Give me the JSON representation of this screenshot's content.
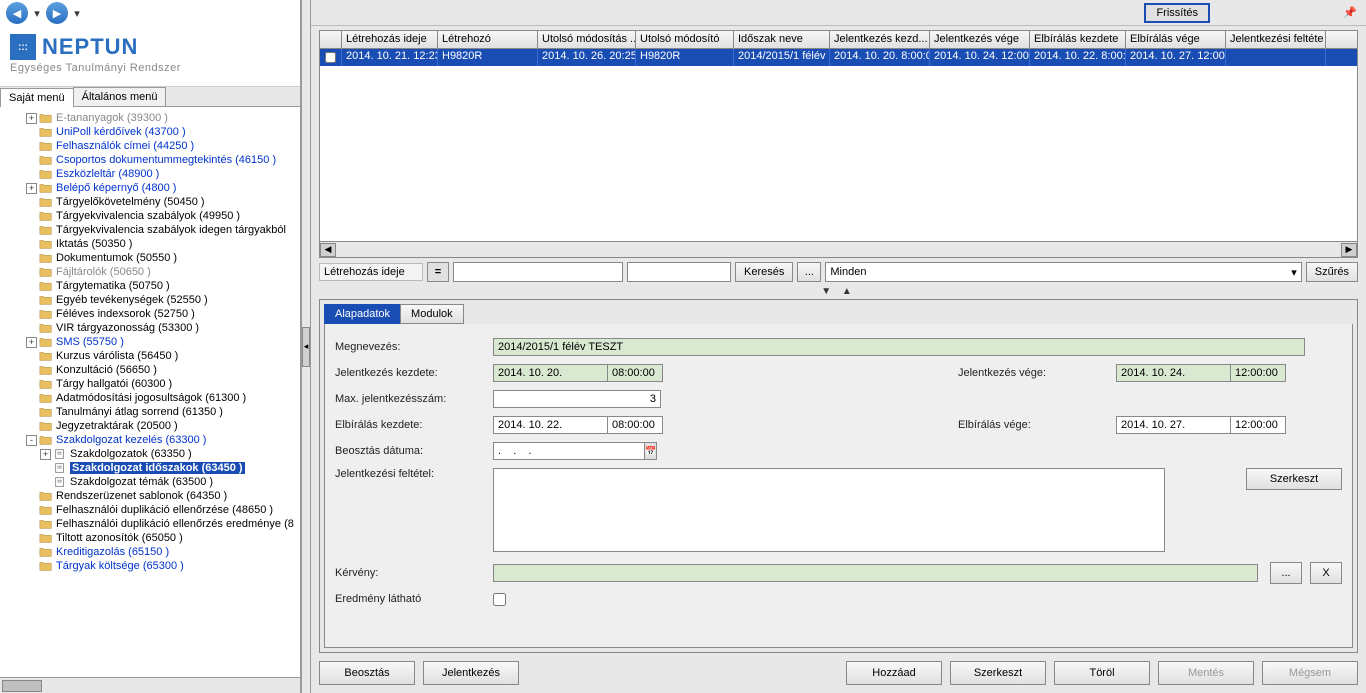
{
  "logo": {
    "name": "NEPTUN",
    "sub": "Egységes Tanulmányi Rendszer"
  },
  "menuTabs": {
    "own": "Saját menü",
    "general": "Általános menü"
  },
  "topbar": {
    "refresh": "Frissítés"
  },
  "tree": [
    {
      "d": 1,
      "exp": "+",
      "label": "E-tananyagok (39300  )",
      "cls": "grey"
    },
    {
      "d": 1,
      "exp": "",
      "label": "UniPoll kérdőívek (43700  )",
      "cls": "link"
    },
    {
      "d": 1,
      "exp": "",
      "label": "Felhasználók címei (44250  )",
      "cls": "link"
    },
    {
      "d": 1,
      "exp": "",
      "label": "Csoportos dokumentummegtekintés (46150  )",
      "cls": "link"
    },
    {
      "d": 1,
      "exp": "",
      "label": "Eszközleltár (48900  )",
      "cls": "link"
    },
    {
      "d": 1,
      "exp": "+",
      "label": "Belépő képernyő (4800  )",
      "cls": "link"
    },
    {
      "d": 1,
      "exp": "",
      "label": "Tárgyelőkövetelmény (50450  )",
      "cls": ""
    },
    {
      "d": 1,
      "exp": "",
      "label": "Tárgyekvivalencia szabályok (49950  )",
      "cls": ""
    },
    {
      "d": 1,
      "exp": "",
      "label": "Tárgyekvivalencia szabályok idegen tárgyakból",
      "cls": ""
    },
    {
      "d": 1,
      "exp": "",
      "label": "Iktatás (50350  )",
      "cls": ""
    },
    {
      "d": 1,
      "exp": "",
      "label": "Dokumentumok (50550  )",
      "cls": ""
    },
    {
      "d": 1,
      "exp": "",
      "label": "Fájltárolók (50650  )",
      "cls": "grey"
    },
    {
      "d": 1,
      "exp": "",
      "label": "Tárgytematika (50750  )",
      "cls": ""
    },
    {
      "d": 1,
      "exp": "",
      "label": "Egyéb tevékenységek (52550  )",
      "cls": ""
    },
    {
      "d": 1,
      "exp": "",
      "label": "Féléves indexsorok (52750  )",
      "cls": ""
    },
    {
      "d": 1,
      "exp": "",
      "label": "VIR tárgyazonosság (53300  )",
      "cls": ""
    },
    {
      "d": 1,
      "exp": "+",
      "label": "SMS (55750  )",
      "cls": "link"
    },
    {
      "d": 1,
      "exp": "",
      "label": "Kurzus várólista (56450  )",
      "cls": ""
    },
    {
      "d": 1,
      "exp": "",
      "label": "Konzultáció (56650  )",
      "cls": ""
    },
    {
      "d": 1,
      "exp": "",
      "label": "Tárgy hallgatói (60300  )",
      "cls": ""
    },
    {
      "d": 1,
      "exp": "",
      "label": "Adatmódosítási jogosultságok (61300  )",
      "cls": ""
    },
    {
      "d": 1,
      "exp": "",
      "label": "Tanulmányi átlag sorrend (61350  )",
      "cls": ""
    },
    {
      "d": 1,
      "exp": "",
      "label": "Jegyzetraktárak (20500  )",
      "cls": ""
    },
    {
      "d": 1,
      "exp": "-",
      "label": "Szakdolgozat kezelés (63300  )",
      "cls": "link"
    },
    {
      "d": 2,
      "exp": "+",
      "label": "Szakdolgozatok (63350  )",
      "cls": "",
      "doc": true
    },
    {
      "d": 2,
      "exp": "",
      "label": "Szakdolgozat időszakok (63450  )",
      "cls": "selected",
      "doc": true
    },
    {
      "d": 2,
      "exp": "",
      "label": "Szakdolgozat témák (63500  )",
      "cls": "",
      "doc": true
    },
    {
      "d": 1,
      "exp": "",
      "label": "Rendszerüzenet sablonok (64350  )",
      "cls": ""
    },
    {
      "d": 1,
      "exp": "",
      "label": "Felhasználói duplikáció ellenőrzése (48650  )",
      "cls": ""
    },
    {
      "d": 1,
      "exp": "",
      "label": "Felhasználói duplikáció ellenőrzés eredménye (8",
      "cls": ""
    },
    {
      "d": 1,
      "exp": "",
      "label": "Tiltott azonosítók (65050  )",
      "cls": ""
    },
    {
      "d": 1,
      "exp": "",
      "label": "Kreditigazolás (65150  )",
      "cls": "link"
    },
    {
      "d": 1,
      "exp": "",
      "label": "Tárgyak költsége (65300  )",
      "cls": "link"
    }
  ],
  "grid": {
    "headers": [
      "",
      "Létrehozás ideje",
      "Létrehozó",
      "Utolsó módosítás ...",
      "Utolsó módosító",
      "Időszak neve",
      "Jelentkezés kezd...",
      "Jelentkezés vége",
      "Elbírálás kezdete",
      "Elbírálás vége",
      "Jelentkezési feltéte"
    ],
    "widths": [
      22,
      96,
      100,
      98,
      98,
      96,
      100,
      100,
      96,
      100,
      100
    ],
    "row": [
      "",
      "2014. 10. 21. 12:23:",
      "H9820R",
      "2014. 10. 26. 20:25:",
      "H9820R",
      "2014/2015/1 félév",
      "2014. 10. 20. 8:00:0",
      "2014. 10. 24. 12:00:",
      "2014. 10. 22. 8:00:0",
      "2014. 10. 27. 12:00:",
      ""
    ]
  },
  "search": {
    "label": "Létrehozás ideje",
    "keres": "Keresés",
    "minden": "Minden",
    "szures": "Szűrés"
  },
  "tabs": {
    "alap": "Alapadatok",
    "mod": "Modulok"
  },
  "form": {
    "megnevezes_l": "Megnevezés:",
    "megnevezes_v": "2014/2015/1 félév TESZT",
    "jelkezd_l": "Jelentkezés kezdete:",
    "jelkezd_d": "2014. 10. 20.",
    "jelkezd_t": "08:00:00",
    "jelvege_l": "Jelentkezés vége:",
    "jelvege_d": "2014. 10. 24.",
    "jelvege_t": "12:00:00",
    "max_l": "Max. jelentkezésszám:",
    "max_v": "3",
    "elbkezd_l": "Elbírálás kezdete:",
    "elbkezd_d": "2014. 10. 22.",
    "elbkezd_t": "08:00:00",
    "elbvege_l": "Elbírálás vége:",
    "elbvege_d": "2014. 10. 27.",
    "elbvege_t": "12:00:00",
    "beoszt_l": "Beosztás dátuma:",
    "beoszt_d": ".    .    .",
    "felt_l": "Jelentkezési feltétel:",
    "szerk": "Szerkeszt",
    "kerveny_l": "Kérvény:",
    "dots": "...",
    "x": "X",
    "eredm_l": "Eredmény látható"
  },
  "actions": {
    "beosztas": "Beosztás",
    "jelentkezes": "Jelentkezés",
    "hozzaad": "Hozzáad",
    "szerkeszt": "Szerkeszt",
    "torol": "Töröl",
    "mentes": "Mentés",
    "megsem": "Mégsem"
  }
}
